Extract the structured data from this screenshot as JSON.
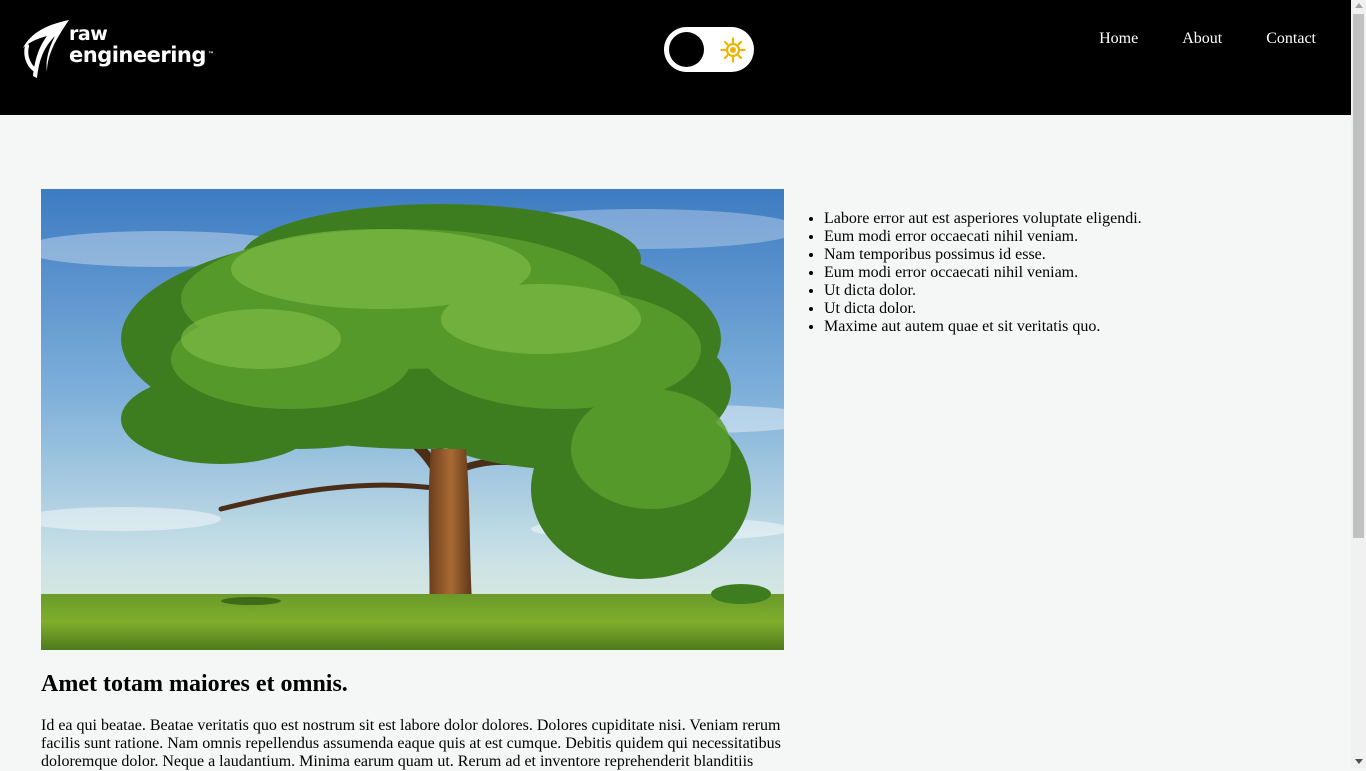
{
  "header": {
    "logo": {
      "line1": "raw",
      "line2": "engineering",
      "tm": "™"
    },
    "theme_toggle": {
      "icon": "sun-icon",
      "state": "dark",
      "sun_color": "#f0b400"
    },
    "nav": [
      {
        "label": "Home"
      },
      {
        "label": "About"
      },
      {
        "label": "Contact"
      }
    ]
  },
  "main": {
    "hero_image": {
      "alt": "tree in a field"
    },
    "list": [
      "Labore error aut est asperiores voluptate eligendi.",
      "Eum modi error occaecati nihil veniam.",
      "Nam temporibus possimus id esse.",
      "Eum modi error occaecati nihil veniam.",
      "Ut dicta dolor.",
      "Ut dicta dolor.",
      "Maxime aut autem quae et sit veritatis quo."
    ],
    "article": {
      "title": "Amet totam maiores et omnis.",
      "body": "Id ea qui beatae. Beatae veritatis quo est nostrum sit est labore dolor dolores. Dolores cupiditate nisi. Veniam rerum facilis sunt ratione. Nam omnis repellendus assumenda eaque quis at est cumque. Debitis quidem qui necessitatibus doloremque dolor. Neque a laudantium. Minima earum quam ut. Rerum ad et inventore reprehenderit blanditiis"
    }
  },
  "colors": {
    "header_bg": "#000000",
    "page_bg": "#f5f7f6",
    "accent_sun": "#f0b400"
  }
}
